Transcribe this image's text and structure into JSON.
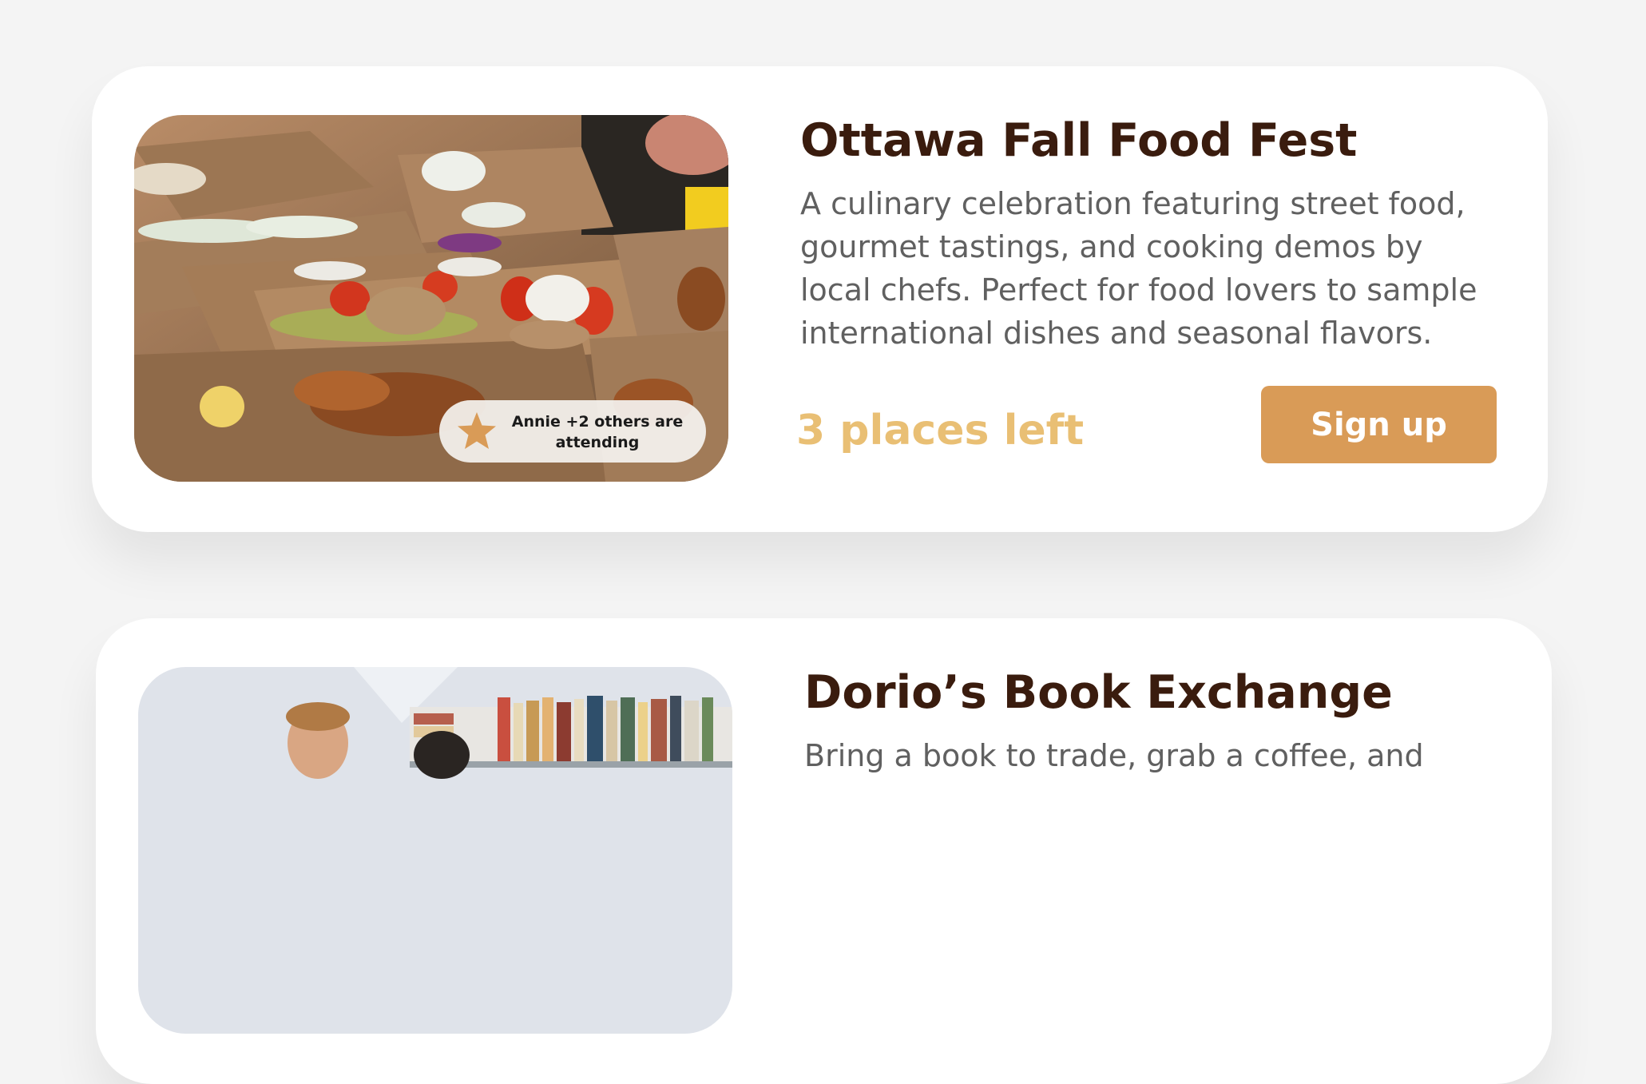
{
  "events": [
    {
      "title": "Ottawa Fall Food Fest",
      "description": "A culinary celebration featuring street food, gourmet tastings, and cooking demos by local chefs. Perfect for food lovers to sample international dishes and seasonal flavors.",
      "places_left": "3 places left",
      "attending": "Annie +2 others are attending",
      "signup_label": "Sign up"
    },
    {
      "title": "Dorio’s Book Exchange",
      "description": "Bring a book to trade, grab a coffee, and"
    }
  ],
  "colors": {
    "page_background": "#f4f4f4",
    "card_background": "#ffffff",
    "title": "#3a1c0e",
    "description": "#606060",
    "places_left": "#e9bf74",
    "signup_button": "#d99b57",
    "star": "#d99b57"
  },
  "icons": {
    "attending": "star-icon"
  }
}
